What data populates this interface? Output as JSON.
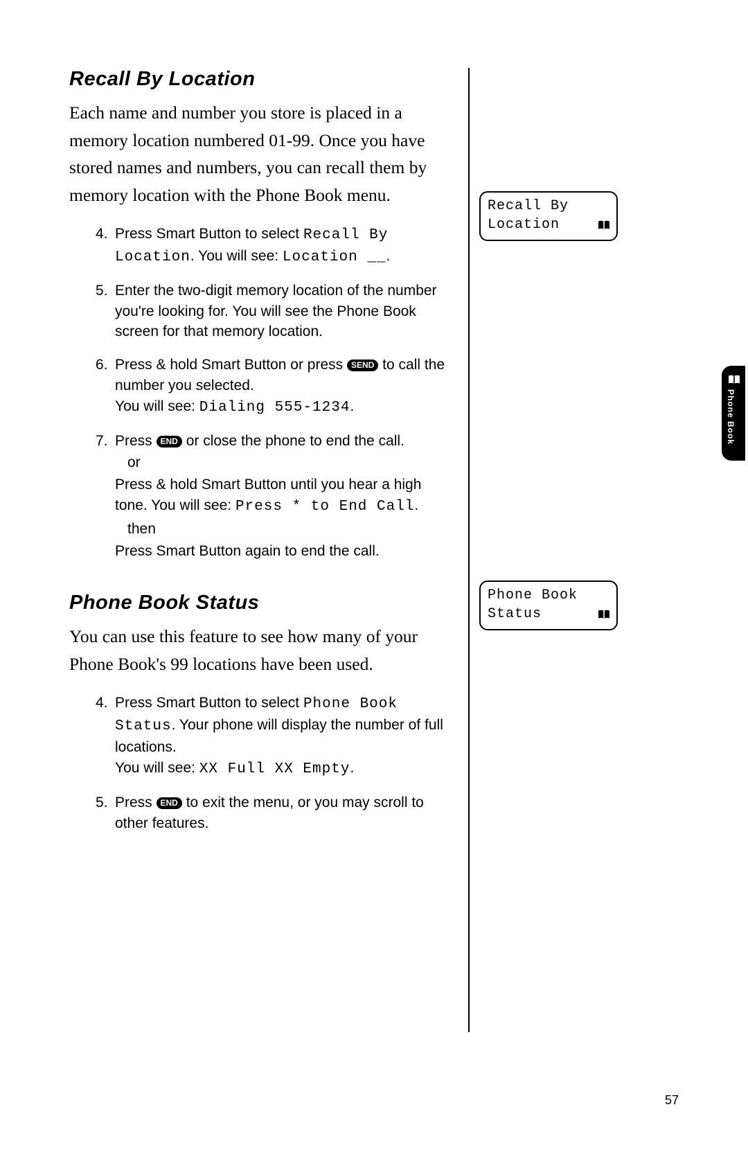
{
  "section1": {
    "heading": "Recall By Location",
    "intro": "Each name and number you store is placed in a memory location numbered 01-99. Once you have stored names and numbers, you can recall them by memory location with the Phone Book menu.",
    "steps": [
      {
        "num": "4.",
        "pre": "Press Smart Button to select ",
        "lcd1": "Recall By Location",
        "mid": ". You will see: ",
        "lcd2": "Location __",
        "post": "."
      },
      {
        "num": "5.",
        "text": "Enter the two-digit memory location of the number you're looking for. You will see the Phone Book screen for that memory location."
      },
      {
        "num": "6.",
        "pre": "Press & hold Smart Button or press ",
        "key": "SEND",
        "mid": " to call the number you selected.",
        "line2_pre": "You will see: ",
        "line2_lcd": "Dialing 555-1234",
        "line2_post": "."
      },
      {
        "num": "7.",
        "pre": "Press ",
        "key": "END",
        "post": " or close the phone to end the call.",
        "or": "or",
        "line2": "Press & hold Smart Button until you hear a high tone. You will see: ",
        "line2_lcd": "Press * to End Call",
        "line2_post": ".",
        "then": "then",
        "line3": "Press Smart Button again to end the call."
      }
    ],
    "screen": {
      "line1": "Recall By",
      "line2": "Location"
    }
  },
  "section2": {
    "heading": "Phone Book Status",
    "intro": "You can use this feature to see how many of your Phone Book's 99 locations have been used.",
    "steps": [
      {
        "num": "4.",
        "pre": "Press Smart Button to select ",
        "lcd1": "Phone Book Status",
        "mid": ". Your phone will display the number of full locations.",
        "line2_pre": "You will see: ",
        "line2_lcd": "XX Full XX Empty",
        "line2_post": "."
      },
      {
        "num": "5.",
        "pre": "Press ",
        "key": "END",
        "post": " to exit the menu, or you may scroll to other features."
      }
    ],
    "screen": {
      "line1": "Phone Book",
      "line2": "Status"
    }
  },
  "tab": {
    "label": "Phone Book"
  },
  "page_number": "57"
}
